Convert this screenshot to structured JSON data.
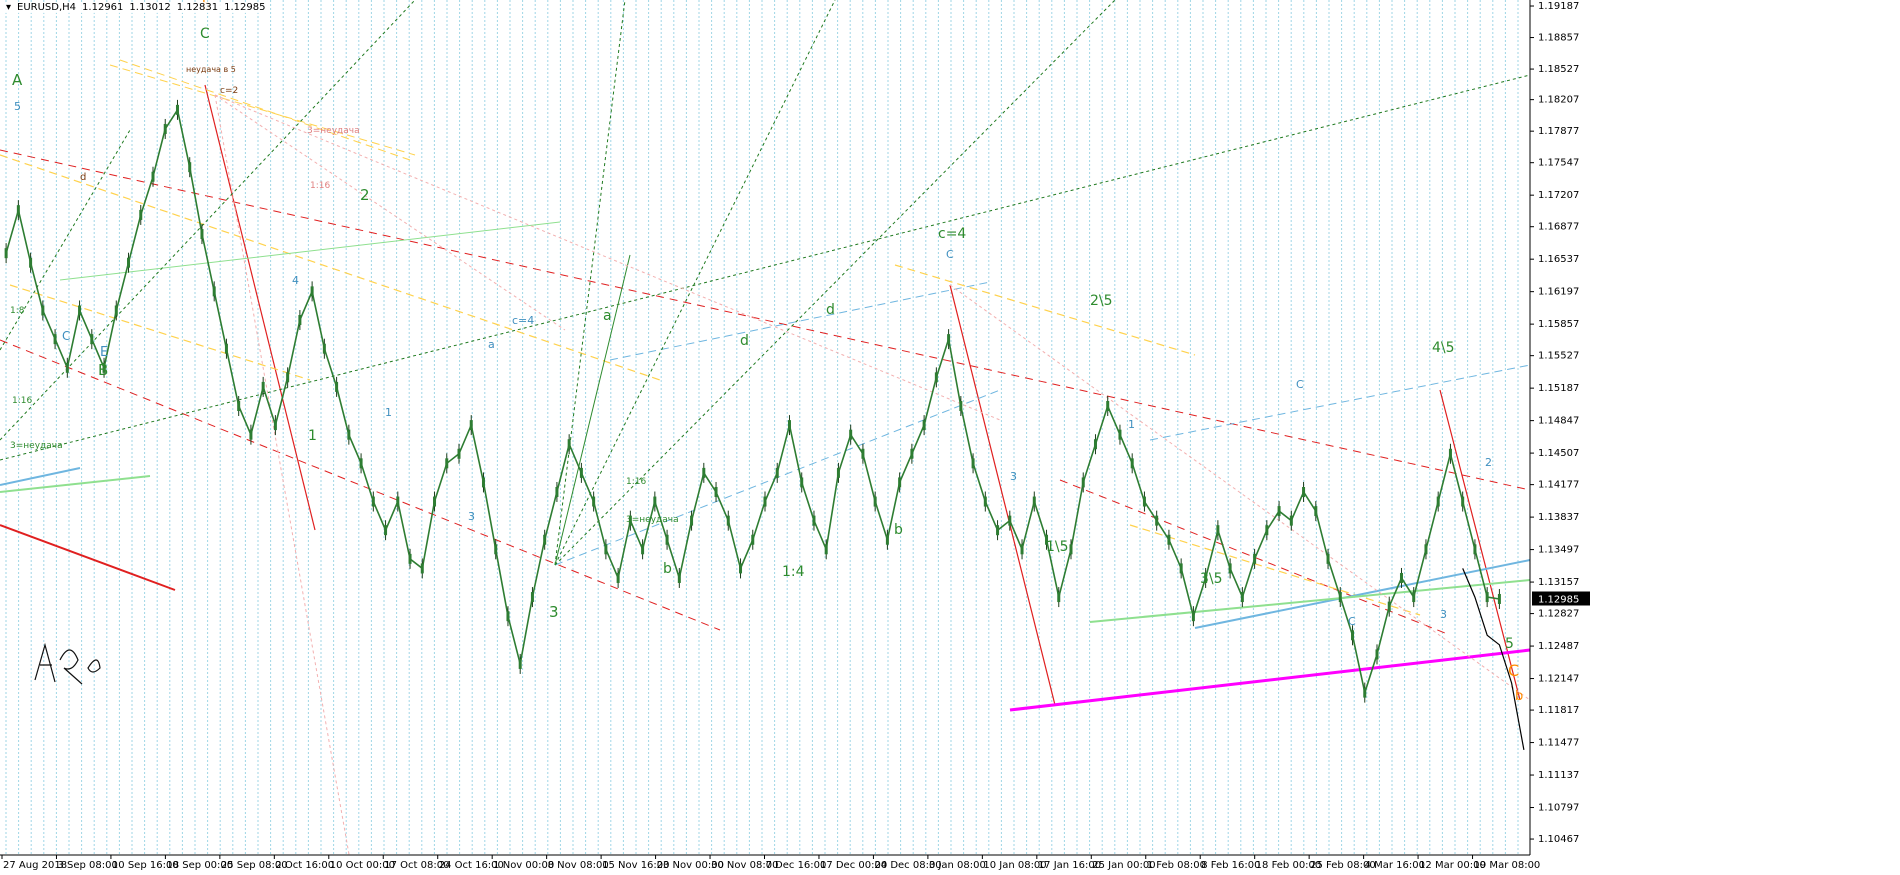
{
  "header": {
    "symbol": "EURUSD,H4",
    "quote": [
      "1.12961",
      "1.13012",
      "1.12831",
      "1.12985"
    ]
  },
  "colors": {
    "background": "#ffffff",
    "vgrid": "#9fd6e6",
    "candle_up": "#2e7d32",
    "candle_down": "#1b3d1b",
    "price_line": "#000000",
    "current_price_box": "#000000",
    "wave_green": "#2e8b2e",
    "wave_blue": "#3f8fbf",
    "wave_brown": "#7a3b10",
    "wave_orange": "#ff8c00",
    "red_line": "#e02020",
    "magenta_line": "#ff00ff",
    "yellow_line": "#ffd24d",
    "lightblue_line": "#6fb6e0",
    "lightgreen_line": "#8fe08f",
    "darkgreen_dash": "#1f7a1f"
  },
  "chart_data": {
    "type": "line",
    "title": "EURUSD,H4",
    "ylim": [
      1.103,
      1.1925
    ],
    "grid": "vertical dotted lines",
    "y_ticks": [
      "1.19187",
      "1.18857",
      "1.18527",
      "1.18207",
      "1.17877",
      "1.17547",
      "1.17207",
      "1.16877",
      "1.16537",
      "1.16197",
      "1.15857",
      "1.15527",
      "1.15187",
      "1.14847",
      "1.14507",
      "1.14177",
      "1.13837",
      "1.13497",
      "1.13157",
      "1.12827",
      "1.12487",
      "1.12147",
      "1.11817",
      "1.11477",
      "1.11137",
      "1.10797",
      "1.10467"
    ],
    "current_price": "1.12985",
    "x_ticks": [
      "27 Aug 2018",
      "3 Sep 08:00",
      "10 Sep 16:00",
      "18 Sep 00:00",
      "25 Sep 08:00",
      "2 Oct 16:00",
      "10 Oct 00:00",
      "17 Oct 08:00",
      "24 Oct 16:00",
      "1 Nov 00:00",
      "8 Nov 08:00",
      "15 Nov 16:00",
      "23 Nov 00:00",
      "30 Nov 08:00",
      "7 Dec 16:00",
      "17 Dec 00:00",
      "24 Dec 08:00",
      "3 Jan 08:00",
      "10 Jan 08:00",
      "17 Jan 16:00",
      "25 Jan 00:00",
      "1 Feb 08:00",
      "8 Feb 16:00",
      "18 Feb 00:00",
      "25 Feb 08:00",
      "4 Mar 16:00",
      "12 Mar 00:00",
      "19 Mar 08:00"
    ],
    "series": [
      {
        "kind": "close_path",
        "points": [
          [
            0,
            1.166
          ],
          [
            1,
            1.1705
          ],
          [
            2,
            1.165
          ],
          [
            3,
            1.16
          ],
          [
            4,
            1.157
          ],
          [
            5,
            1.154
          ],
          [
            6,
            1.16
          ],
          [
            7,
            1.157
          ],
          [
            8,
            1.154
          ],
          [
            9,
            1.16
          ],
          [
            10,
            1.165
          ],
          [
            11,
            1.17
          ],
          [
            12,
            1.174
          ],
          [
            13,
            1.179
          ],
          [
            14,
            1.181
          ],
          [
            15,
            1.175
          ],
          [
            16,
            1.168
          ],
          [
            17,
            1.162
          ],
          [
            18,
            1.156
          ],
          [
            19,
            1.15
          ],
          [
            20,
            1.147
          ],
          [
            21,
            1.152
          ],
          [
            22,
            1.148
          ],
          [
            23,
            1.153
          ],
          [
            24,
            1.159
          ],
          [
            25,
            1.162
          ],
          [
            26,
            1.156
          ],
          [
            27,
            1.152
          ],
          [
            28,
            1.147
          ],
          [
            29,
            1.144
          ],
          [
            30,
            1.14
          ],
          [
            31,
            1.137
          ],
          [
            32,
            1.14
          ],
          [
            33,
            1.134
          ],
          [
            34,
            1.133
          ],
          [
            35,
            1.14
          ],
          [
            36,
            1.144
          ],
          [
            37,
            1.145
          ],
          [
            38,
            1.148
          ],
          [
            39,
            1.142
          ],
          [
            40,
            1.135
          ],
          [
            41,
            1.128
          ],
          [
            42,
            1.123
          ],
          [
            43,
            1.13
          ],
          [
            44,
            1.136
          ],
          [
            45,
            1.141
          ],
          [
            46,
            1.146
          ],
          [
            47,
            1.143
          ],
          [
            48,
            1.14
          ],
          [
            49,
            1.135
          ],
          [
            50,
            1.132
          ],
          [
            51,
            1.138
          ],
          [
            52,
            1.135
          ],
          [
            53,
            1.14
          ],
          [
            54,
            1.136
          ],
          [
            55,
            1.132
          ],
          [
            56,
            1.138
          ],
          [
            57,
            1.143
          ],
          [
            58,
            1.141
          ],
          [
            59,
            1.138
          ],
          [
            60,
            1.133
          ],
          [
            61,
            1.136
          ],
          [
            62,
            1.14
          ],
          [
            63,
            1.143
          ],
          [
            64,
            1.148
          ],
          [
            65,
            1.142
          ],
          [
            66,
            1.138
          ],
          [
            67,
            1.135
          ],
          [
            68,
            1.143
          ],
          [
            69,
            1.147
          ],
          [
            70,
            1.145
          ],
          [
            71,
            1.14
          ],
          [
            72,
            1.136
          ],
          [
            73,
            1.142
          ],
          [
            74,
            1.145
          ],
          [
            75,
            1.148
          ],
          [
            76,
            1.153
          ],
          [
            77,
            1.157
          ],
          [
            78,
            1.15
          ],
          [
            79,
            1.144
          ],
          [
            80,
            1.14
          ],
          [
            81,
            1.137
          ],
          [
            82,
            1.138
          ],
          [
            83,
            1.135
          ],
          [
            84,
            1.14
          ],
          [
            85,
            1.136
          ],
          [
            86,
            1.13
          ],
          [
            87,
            1.135
          ],
          [
            88,
            1.142
          ],
          [
            89,
            1.146
          ],
          [
            90,
            1.15
          ],
          [
            91,
            1.147
          ],
          [
            92,
            1.144
          ],
          [
            93,
            1.14
          ],
          [
            94,
            1.138
          ],
          [
            95,
            1.136
          ],
          [
            96,
            1.133
          ],
          [
            97,
            1.128
          ],
          [
            98,
            1.132
          ],
          [
            99,
            1.137
          ],
          [
            100,
            1.133
          ],
          [
            101,
            1.13
          ],
          [
            102,
            1.134
          ],
          [
            103,
            1.137
          ],
          [
            104,
            1.139
          ],
          [
            105,
            1.138
          ],
          [
            106,
            1.141
          ],
          [
            107,
            1.139
          ],
          [
            108,
            1.134
          ],
          [
            109,
            1.13
          ],
          [
            110,
            1.126
          ],
          [
            111,
            1.12
          ],
          [
            112,
            1.124
          ],
          [
            113,
            1.129
          ],
          [
            114,
            1.132
          ],
          [
            115,
            1.13
          ],
          [
            116,
            1.135
          ],
          [
            117,
            1.14
          ],
          [
            118,
            1.145
          ],
          [
            119,
            1.14
          ],
          [
            120,
            1.135
          ],
          [
            121,
            1.13
          ],
          [
            122,
            1.1298
          ]
        ]
      },
      {
        "kind": "forecast_path",
        "points": [
          [
            119,
            1.133
          ],
          [
            120,
            1.13
          ],
          [
            121,
            1.126
          ],
          [
            122,
            1.125
          ],
          [
            123,
            1.121
          ],
          [
            124,
            1.114
          ]
        ]
      }
    ],
    "annotations": [
      "A",
      "5",
      "B",
      "C",
      "b",
      "E",
      "d",
      "a",
      "1",
      "2",
      "3",
      "4",
      "c=4",
      "c=2",
      "1\\5",
      "2\\5",
      "3\\5",
      "4\\5",
      "x",
      "1:4",
      "1:8",
      "1:16",
      "3=неудача",
      "неудача в 5"
    ]
  }
}
